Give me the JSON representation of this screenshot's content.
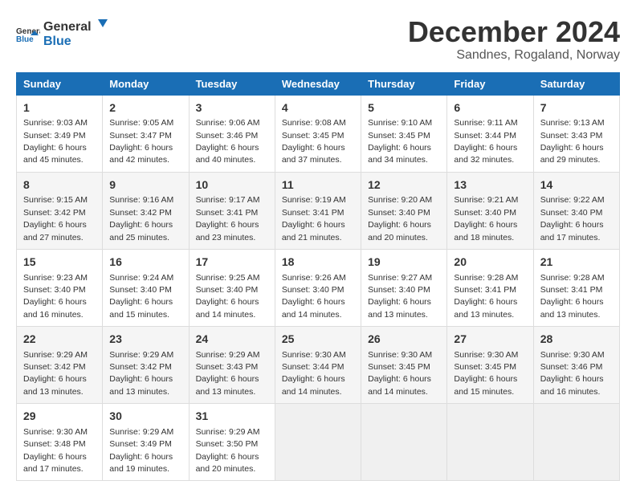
{
  "logo": {
    "line1": "General",
    "line2": "Blue"
  },
  "title": "December 2024",
  "subtitle": "Sandnes, Rogaland, Norway",
  "days_header": [
    "Sunday",
    "Monday",
    "Tuesday",
    "Wednesday",
    "Thursday",
    "Friday",
    "Saturday"
  ],
  "weeks": [
    [
      {
        "num": "1",
        "sunrise": "9:03 AM",
        "sunset": "3:49 PM",
        "daylight": "6 hours and 45 minutes."
      },
      {
        "num": "2",
        "sunrise": "9:05 AM",
        "sunset": "3:47 PM",
        "daylight": "6 hours and 42 minutes."
      },
      {
        "num": "3",
        "sunrise": "9:06 AM",
        "sunset": "3:46 PM",
        "daylight": "6 hours and 40 minutes."
      },
      {
        "num": "4",
        "sunrise": "9:08 AM",
        "sunset": "3:45 PM",
        "daylight": "6 hours and 37 minutes."
      },
      {
        "num": "5",
        "sunrise": "9:10 AM",
        "sunset": "3:45 PM",
        "daylight": "6 hours and 34 minutes."
      },
      {
        "num": "6",
        "sunrise": "9:11 AM",
        "sunset": "3:44 PM",
        "daylight": "6 hours and 32 minutes."
      },
      {
        "num": "7",
        "sunrise": "9:13 AM",
        "sunset": "3:43 PM",
        "daylight": "6 hours and 29 minutes."
      }
    ],
    [
      {
        "num": "8",
        "sunrise": "9:15 AM",
        "sunset": "3:42 PM",
        "daylight": "6 hours and 27 minutes."
      },
      {
        "num": "9",
        "sunrise": "9:16 AM",
        "sunset": "3:42 PM",
        "daylight": "6 hours and 25 minutes."
      },
      {
        "num": "10",
        "sunrise": "9:17 AM",
        "sunset": "3:41 PM",
        "daylight": "6 hours and 23 minutes."
      },
      {
        "num": "11",
        "sunrise": "9:19 AM",
        "sunset": "3:41 PM",
        "daylight": "6 hours and 21 minutes."
      },
      {
        "num": "12",
        "sunrise": "9:20 AM",
        "sunset": "3:40 PM",
        "daylight": "6 hours and 20 minutes."
      },
      {
        "num": "13",
        "sunrise": "9:21 AM",
        "sunset": "3:40 PM",
        "daylight": "6 hours and 18 minutes."
      },
      {
        "num": "14",
        "sunrise": "9:22 AM",
        "sunset": "3:40 PM",
        "daylight": "6 hours and 17 minutes."
      }
    ],
    [
      {
        "num": "15",
        "sunrise": "9:23 AM",
        "sunset": "3:40 PM",
        "daylight": "6 hours and 16 minutes."
      },
      {
        "num": "16",
        "sunrise": "9:24 AM",
        "sunset": "3:40 PM",
        "daylight": "6 hours and 15 minutes."
      },
      {
        "num": "17",
        "sunrise": "9:25 AM",
        "sunset": "3:40 PM",
        "daylight": "6 hours and 14 minutes."
      },
      {
        "num": "18",
        "sunrise": "9:26 AM",
        "sunset": "3:40 PM",
        "daylight": "6 hours and 14 minutes."
      },
      {
        "num": "19",
        "sunrise": "9:27 AM",
        "sunset": "3:40 PM",
        "daylight": "6 hours and 13 minutes."
      },
      {
        "num": "20",
        "sunrise": "9:28 AM",
        "sunset": "3:41 PM",
        "daylight": "6 hours and 13 minutes."
      },
      {
        "num": "21",
        "sunrise": "9:28 AM",
        "sunset": "3:41 PM",
        "daylight": "6 hours and 13 minutes."
      }
    ],
    [
      {
        "num": "22",
        "sunrise": "9:29 AM",
        "sunset": "3:42 PM",
        "daylight": "6 hours and 13 minutes."
      },
      {
        "num": "23",
        "sunrise": "9:29 AM",
        "sunset": "3:42 PM",
        "daylight": "6 hours and 13 minutes."
      },
      {
        "num": "24",
        "sunrise": "9:29 AM",
        "sunset": "3:43 PM",
        "daylight": "6 hours and 13 minutes."
      },
      {
        "num": "25",
        "sunrise": "9:30 AM",
        "sunset": "3:44 PM",
        "daylight": "6 hours and 14 minutes."
      },
      {
        "num": "26",
        "sunrise": "9:30 AM",
        "sunset": "3:45 PM",
        "daylight": "6 hours and 14 minutes."
      },
      {
        "num": "27",
        "sunrise": "9:30 AM",
        "sunset": "3:45 PM",
        "daylight": "6 hours and 15 minutes."
      },
      {
        "num": "28",
        "sunrise": "9:30 AM",
        "sunset": "3:46 PM",
        "daylight": "6 hours and 16 minutes."
      }
    ],
    [
      {
        "num": "29",
        "sunrise": "9:30 AM",
        "sunset": "3:48 PM",
        "daylight": "6 hours and 17 minutes."
      },
      {
        "num": "30",
        "sunrise": "9:29 AM",
        "sunset": "3:49 PM",
        "daylight": "6 hours and 19 minutes."
      },
      {
        "num": "31",
        "sunrise": "9:29 AM",
        "sunset": "3:50 PM",
        "daylight": "6 hours and 20 minutes."
      },
      null,
      null,
      null,
      null
    ]
  ],
  "labels": {
    "sunrise": "Sunrise:",
    "sunset": "Sunset:",
    "daylight": "Daylight:"
  }
}
